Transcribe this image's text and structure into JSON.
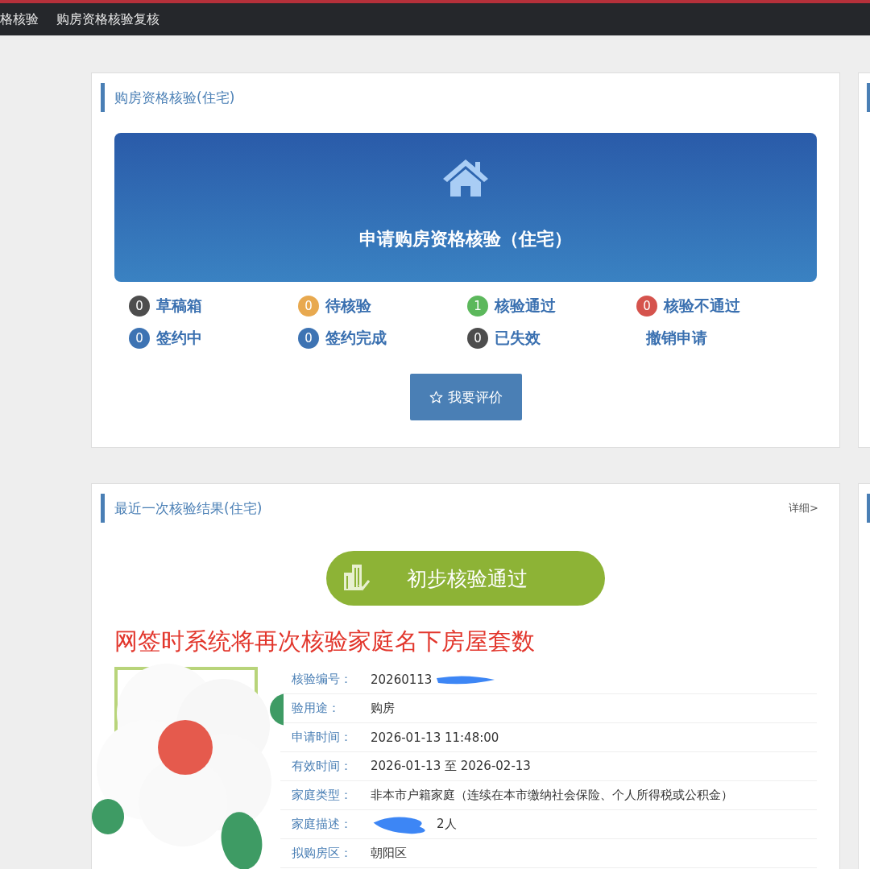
{
  "nav": {
    "items": [
      {
        "label": "格核验"
      },
      {
        "label": "购房资格核验复核"
      }
    ]
  },
  "qualification_card": {
    "title": "购房资格核验(住宅)",
    "banner": {
      "label": "申请购房资格核验（住宅）"
    },
    "stats": [
      {
        "kind": "count",
        "count": "0",
        "label": "草稿箱",
        "color": "#4d4d4d"
      },
      {
        "kind": "count",
        "count": "0",
        "label": "待核验",
        "color": "#e8a94f"
      },
      {
        "kind": "count",
        "count": "1",
        "label": "核验通过",
        "color": "#5cb85c"
      },
      {
        "kind": "count",
        "count": "0",
        "label": "核验不通过",
        "color": "#d5534d"
      },
      {
        "kind": "count",
        "count": "0",
        "label": "签约中",
        "color": "#3d73b3"
      },
      {
        "kind": "count",
        "count": "0",
        "label": "签约完成",
        "color": "#3d73b3"
      },
      {
        "kind": "count",
        "count": "0",
        "label": "已失效",
        "color": "#4d4d4d"
      },
      {
        "kind": "link",
        "label": "撤销申请"
      }
    ],
    "rate_button": {
      "label": "我要评价"
    }
  },
  "result_card": {
    "title": "最近一次核验结果(住宅)",
    "detail_link": "详细>",
    "status": "初步核验通过",
    "notice": "网签时系统将再次核验家庭名下房屋套数",
    "fields": [
      {
        "kind": "tailmasked",
        "label": "核验编号：",
        "value": "20260113"
      },
      {
        "kind": "plain",
        "label": "验用途：",
        "value": "购房"
      },
      {
        "kind": "plain",
        "label": "申请时间：",
        "value": "2026-01-13 11:48:00"
      },
      {
        "kind": "plain",
        "label": "有效时间：",
        "value": "2026-01-13 至 2026-02-13"
      },
      {
        "kind": "plain",
        "label": "家庭类型：",
        "value": "非本市户籍家庭（连续在本市缴纳社会保险、个人所得税或公积金）"
      },
      {
        "kind": "headmasked",
        "label": "家庭描述：",
        "value": "2人"
      },
      {
        "kind": "plain",
        "label": "拟购房区：",
        "value": "朝阳区"
      }
    ]
  }
}
